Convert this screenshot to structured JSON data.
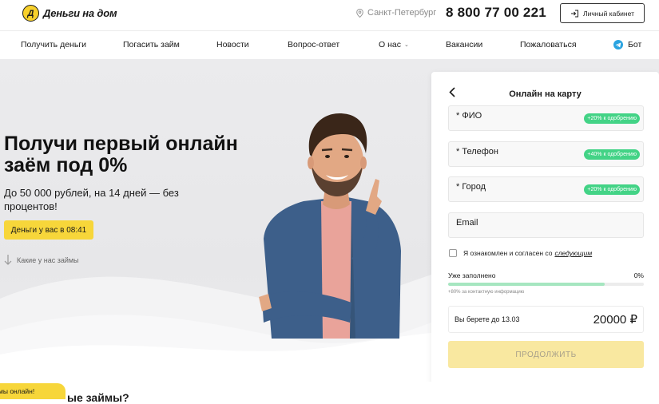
{
  "header": {
    "logo_mark": "Д",
    "logo_text": "Деньги на дом",
    "city": "Санкт-Петербург",
    "phone": "8 800 77 00 221",
    "cabinet_label": "Личный кабинет"
  },
  "nav": {
    "items": [
      {
        "label": "Получить деньги"
      },
      {
        "label": "Погасить займ"
      },
      {
        "label": "Новости"
      },
      {
        "label": "Вопрос-ответ"
      },
      {
        "label": "О нас"
      },
      {
        "label": "Вакансии"
      },
      {
        "label": "Пожаловаться"
      },
      {
        "label": "Бот"
      }
    ]
  },
  "hero": {
    "title": "Получи первый онлайн заём под 0%",
    "subtitle": "До 50 000 рублей, на 14 дней — без процентов!",
    "promo_button": "Деньги у вас в 08:41",
    "loans_link": "Какие у нас займы"
  },
  "form": {
    "title": "Онлайн на карту",
    "fields": [
      {
        "label": "* ФИО",
        "badge": "+20% к одобрению"
      },
      {
        "label": "* Телефон",
        "badge": "+40% к одобрению"
      },
      {
        "label": "* Город",
        "badge": "+20% к одобрению"
      },
      {
        "label": "Email",
        "badge": ""
      }
    ],
    "agree_text": "Я ознакомлен и согласен со",
    "agree_link": "следующим",
    "filled_label": "Уже заполнено",
    "filled_percent": "0%",
    "filled_value": 0.8,
    "filled_note": "+80% за контактную информацию",
    "repay_label": "Вы берете до 13.03",
    "repay_amount": "20000 ₽",
    "continue_label": "ПРОДОЛЖИТЬ"
  },
  "bottom": {
    "online_badge": "мы онлайн!",
    "heading_fragment": "ые займы?"
  },
  "colors": {
    "accent_yellow": "#f7d63a",
    "badge_green": "#43d386",
    "telegram_blue": "#2aa3e0"
  }
}
